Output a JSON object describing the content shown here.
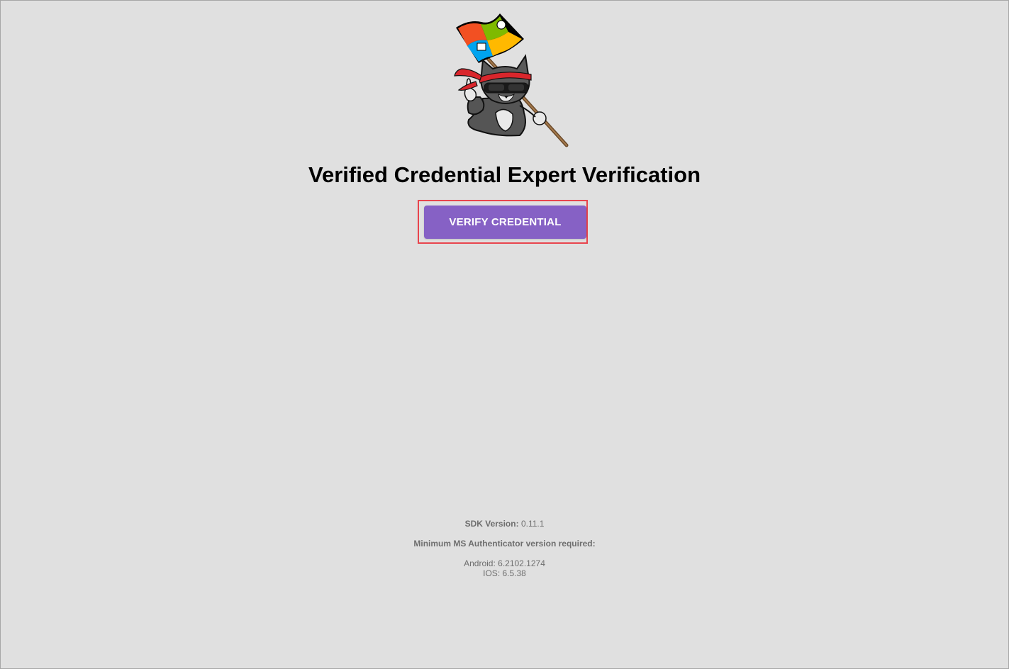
{
  "page": {
    "title": "Verified Credential Expert Verification"
  },
  "actions": {
    "verify_label": "VERIFY CREDENTIAL"
  },
  "footer": {
    "sdk_label": "SDK Version:",
    "sdk_value": "0.11.1",
    "min_version_label": "Minimum MS Authenticator version required:",
    "android": "Android: 6.2102.1274",
    "ios": "IOS: 6.5.38"
  },
  "colors": {
    "background": "#e0e0e0",
    "button": "#8661c5",
    "highlight": "#e8454d"
  },
  "icons": {
    "mascot": "ninja-cat-with-windows-flag"
  }
}
